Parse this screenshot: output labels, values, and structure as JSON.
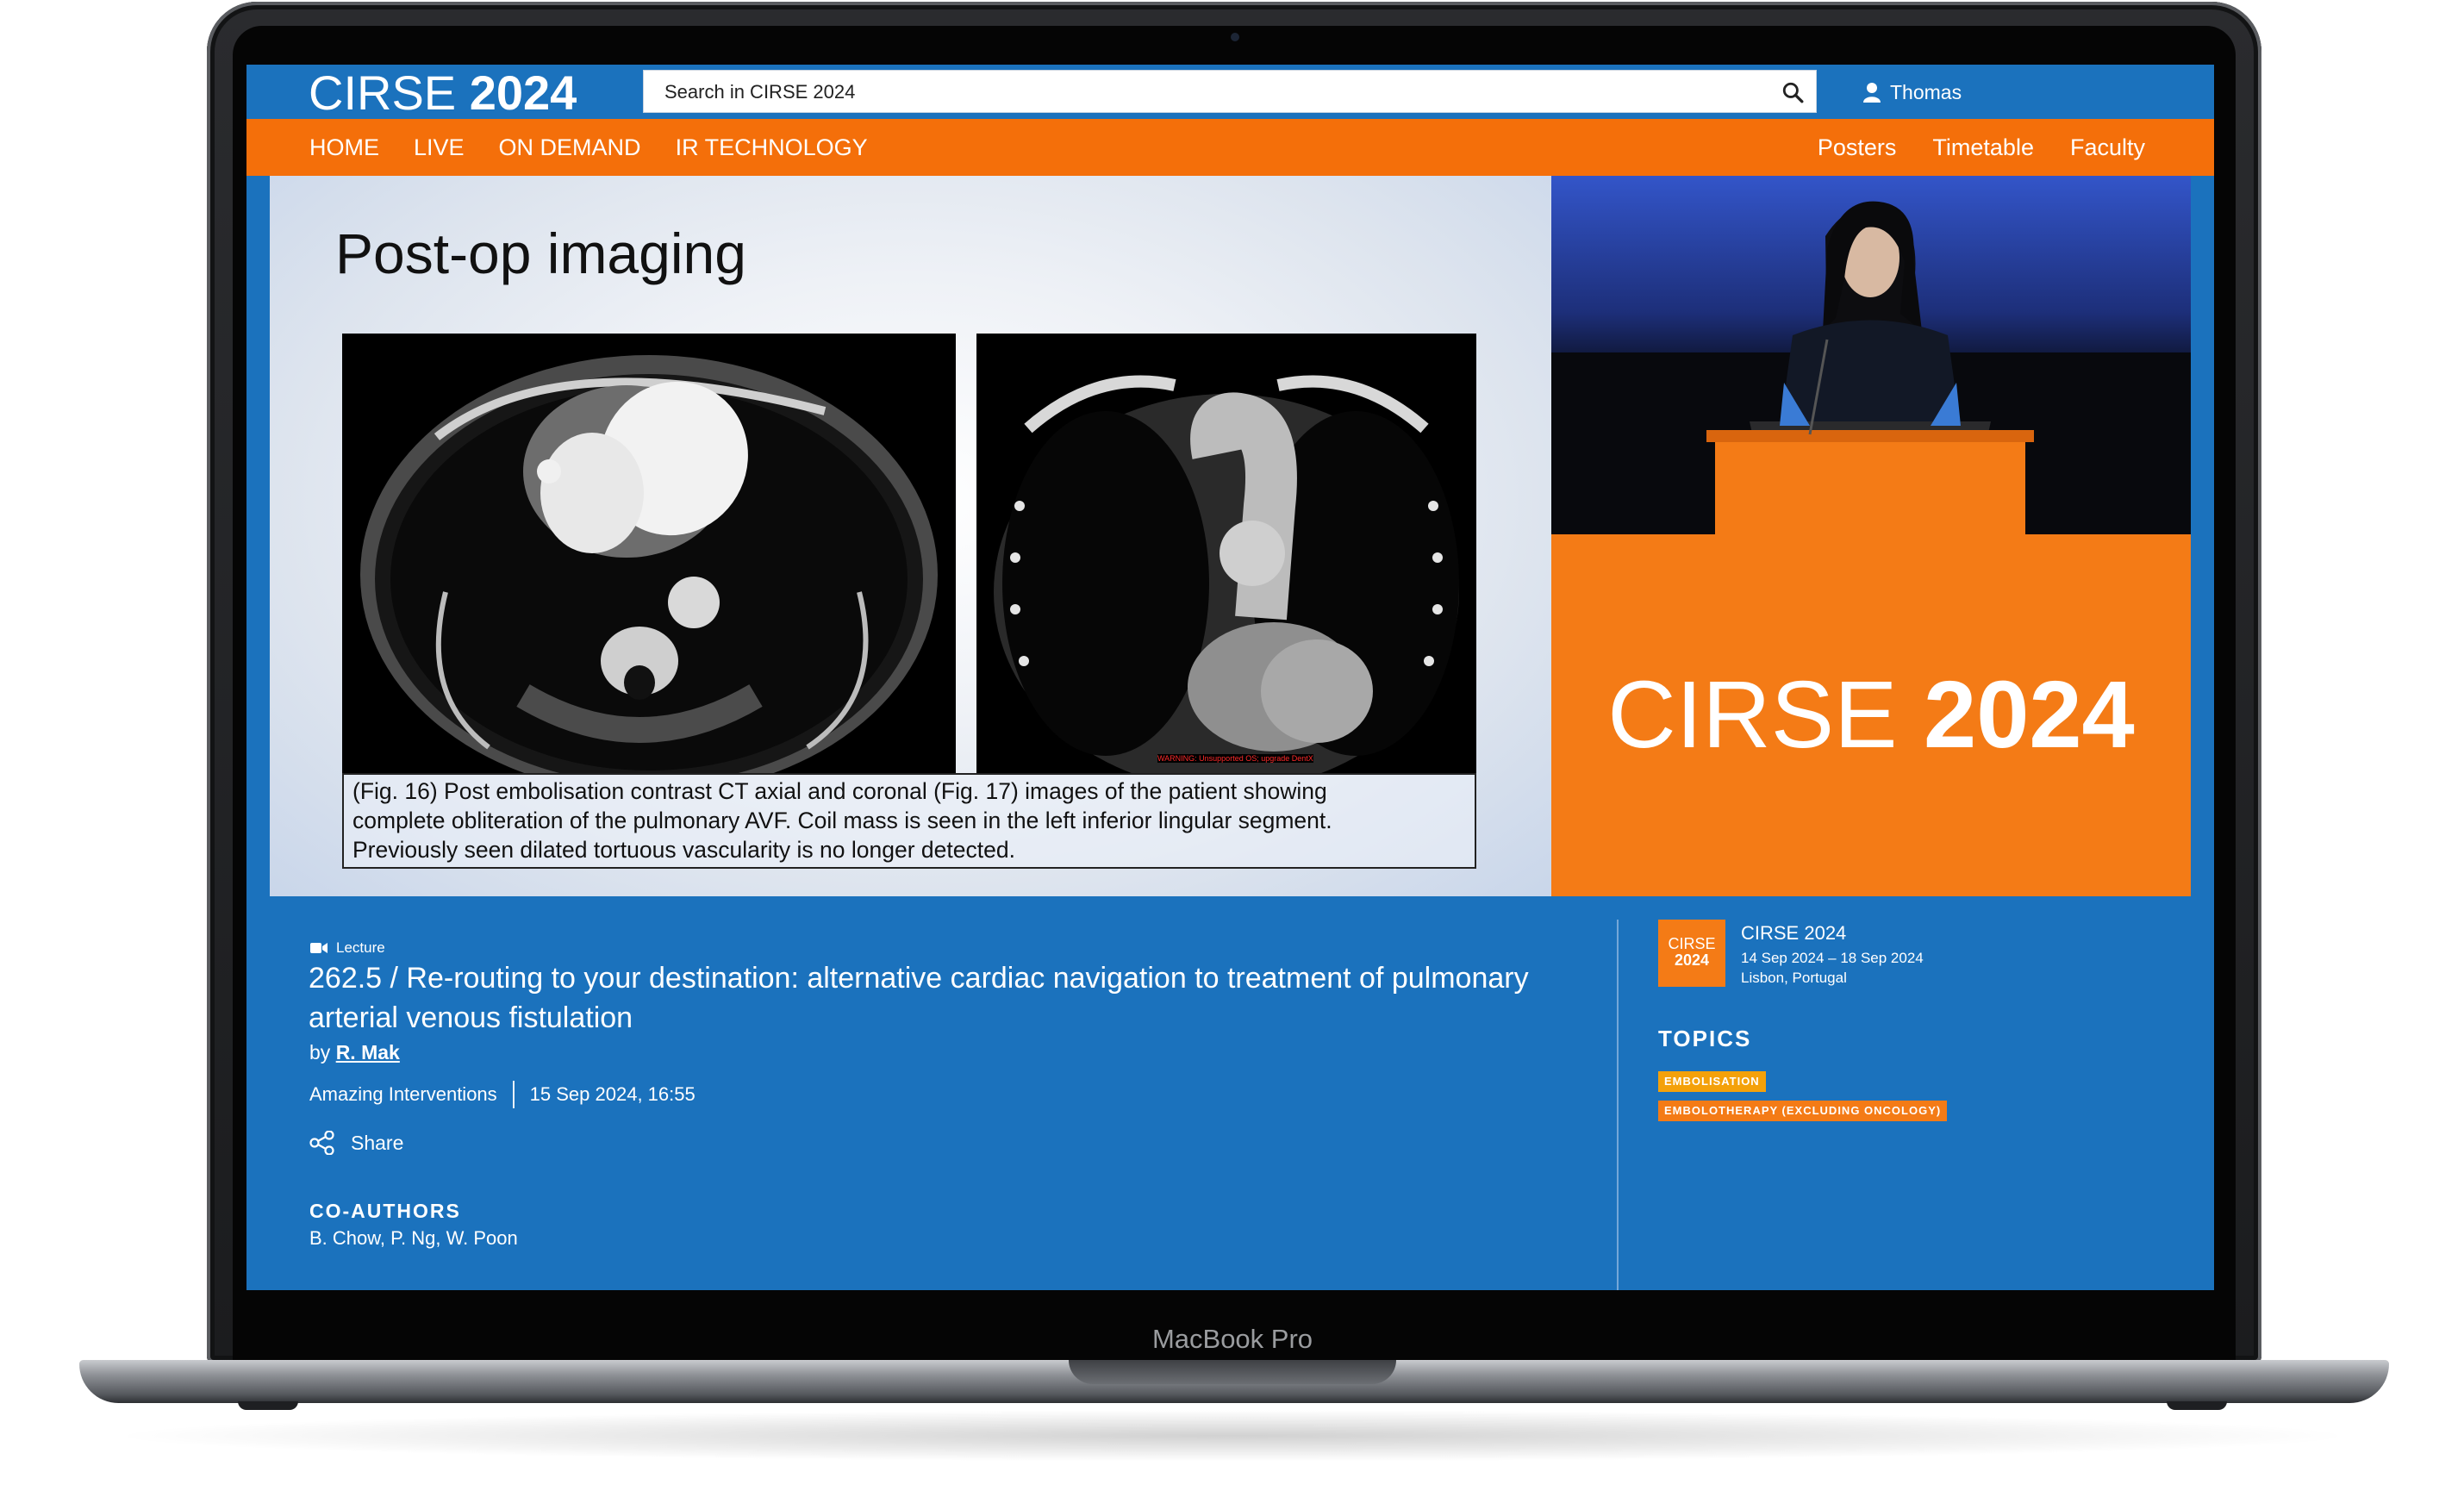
{
  "device": {
    "label": "MacBook Pro"
  },
  "header": {
    "logo_light": "CIR",
    "logo_light2": "SE",
    "logo_bold": "2024",
    "search_placeholder": "Search in CIRSE 2024",
    "user_name": "Thomas"
  },
  "nav": {
    "left": [
      "HOME",
      "LIVE",
      "ON DEMAND",
      "IR TECHNOLOGY"
    ],
    "right": [
      "Posters",
      "Timetable",
      "Faculty"
    ]
  },
  "slide": {
    "title": "Post-op imaging",
    "caption_lines": [
      "(Fig. 16)  Post embolisation contrast CT axial and coronal (Fig. 17) images of the patient showing",
      "complete obliteration of the pulmonary AVF.  Coil mass is seen in the left inferior lingular segment.",
      "Previously seen dilated tortuous vascularity is no longer detected."
    ],
    "warning": "WARNING: Unsupported OS; upgrade DentX"
  },
  "stage": {
    "logo_light": "CIRSE",
    "logo_bold": "2024"
  },
  "talk": {
    "type": "Lecture",
    "title": "262.5 / Re-routing to your destination: alternative cardiac navigation to treatment of pulmonary arterial venous fistulation",
    "by_prefix": "by",
    "author": "R. Mak",
    "session": "Amazing Interventions",
    "datetime": "15 Sep 2024, 16:55",
    "share_label": "Share",
    "coauthors_heading": "CO-AUTHORS",
    "coauthors": "B. Chow, P. Ng, W. Poon"
  },
  "event": {
    "badge_top": "CIRSE",
    "badge_bottom": "2024",
    "name": "CIRSE 2024",
    "dates": "14 Sep 2024 – 18 Sep 2024",
    "location": "Lisbon, Portugal"
  },
  "topics": {
    "heading": "TOPICS",
    "tags": [
      "EMBOLISATION",
      "EMBOLOTHERAPY (EXCLUDING ONCOLOGY)"
    ]
  },
  "colors": {
    "brand_blue": "#1b72bd",
    "brand_orange": "#f46f0a",
    "tag_yellow": "#f4a10a"
  }
}
